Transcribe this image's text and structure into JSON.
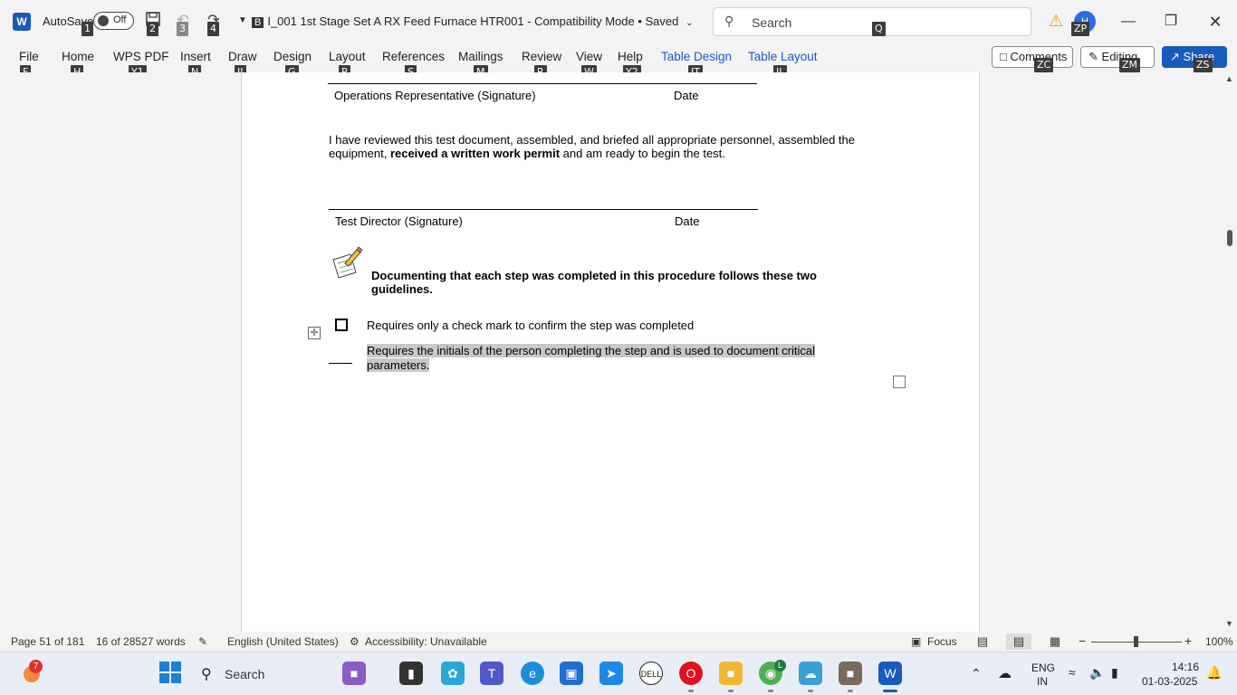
{
  "titlebar": {
    "app_logo": "W",
    "autosave_label": "AutoSave",
    "autosave_state": "Off",
    "doc_badge": "B",
    "doc_title": "I_001 1st Stage Set A RX Feed Furnace HTR001  -  Compatibility Mode • Saved",
    "search_placeholder": "Search",
    "avatar_initial": "H",
    "keytips": {
      "autosave": "1",
      "save": "2",
      "undo": "3",
      "redo": "4",
      "search": "Q",
      "profile": "ZP"
    }
  },
  "ribbon": {
    "tabs": [
      {
        "label": "File",
        "keytip": "F"
      },
      {
        "label": "Home",
        "keytip": "H"
      },
      {
        "label": "WPS PDF",
        "keytip": "Y1"
      },
      {
        "label": "Insert",
        "keytip": "N"
      },
      {
        "label": "Draw",
        "keytip": "JI"
      },
      {
        "label": "Design",
        "keytip": "G"
      },
      {
        "label": "Layout",
        "keytip": "P"
      },
      {
        "label": "References",
        "keytip": "S"
      },
      {
        "label": "Mailings",
        "keytip": "M"
      },
      {
        "label": "Review",
        "keytip": "R"
      },
      {
        "label": "View",
        "keytip": "W"
      },
      {
        "label": "Help",
        "keytip": "Y2"
      },
      {
        "label": "Table Design",
        "keytip": "JT"
      },
      {
        "label": "Table Layout",
        "keytip": "JL"
      }
    ],
    "comments_label": "Comments",
    "comments_keytip": "ZC",
    "editing_label": "Editing",
    "editing_keytip": "ZM",
    "share_label": "Share",
    "share_keytip": "ZS"
  },
  "document": {
    "ops_rep_signature": "Operations Representative (Signature)",
    "date_label_1": "Date",
    "review_para_plain_1": "I have reviewed this test document, assembled, and briefed all appropriate personnel, assembled the equipment, ",
    "review_para_bold": "received a written work permit",
    "review_para_plain_2": " and am ready to begin the test.",
    "test_director_signature": "Test Director (Signature)",
    "date_label_2": "Date",
    "guidelines_heading": "Documenting that each step was completed in this procedure follows these two guidelines.",
    "checkmark_guideline": "Requires only a check mark to confirm the step was completed",
    "initials_guideline": "Requires the initials of the person completing the step and is used to document critical parameters."
  },
  "statusbar": {
    "page": "Page 51 of 181",
    "words": "16 of 28527 words",
    "language": "English (United States)",
    "accessibility": "Accessibility: Unavailable",
    "focus": "Focus",
    "zoom": "100%"
  },
  "taskbar": {
    "weather_badge": "7",
    "search_label": "Search",
    "chrome_badge": "L",
    "lang_line1": "ENG",
    "lang_line2": "IN",
    "time": "14:16",
    "date": "01-03-2025"
  },
  "colors": {
    "word_blue": "#185abd",
    "highlight_gray": "#c8c8c8",
    "warning": "#e6a100"
  }
}
